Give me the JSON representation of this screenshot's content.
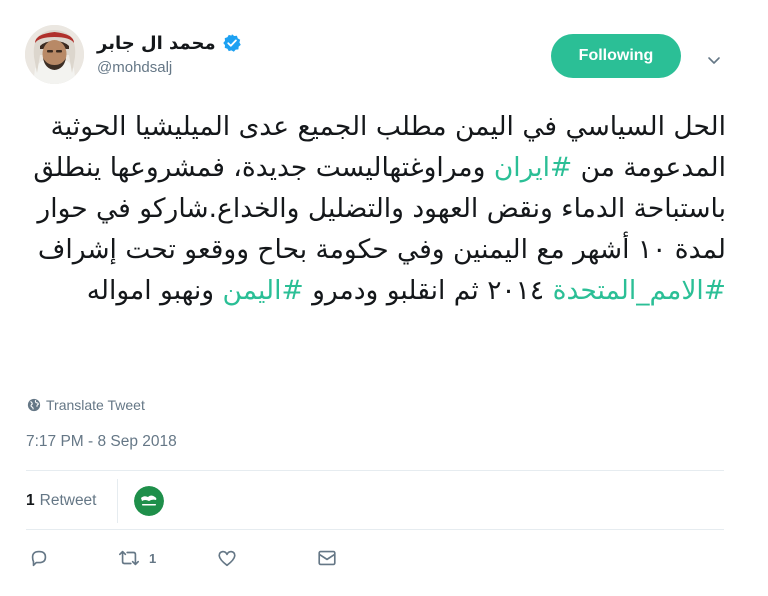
{
  "header": {
    "display_name": "محمد ال جابر",
    "handle": "@mohdsalj",
    "follow_label": "Following",
    "verified": true
  },
  "tweet": {
    "segments": [
      {
        "type": "text",
        "text": "الحل السياسي في اليمن مطلب الجميع عدى الميليشيا الحوثية المدعومة من "
      },
      {
        "type": "hashtag",
        "text": "#ايران"
      },
      {
        "type": "text",
        "text": " ومراوغتهاليست جديدة، فمشروعها ينطلق باستباحة الدماء ونقض العهود والتضليل والخداع.شاركو في حوار لمدة ١٠ أشهر مع اليمنين وفي حكومة بحاح ووقعو تحت إشراف "
      },
      {
        "type": "hashtag",
        "text": "#الامم_المتحدة"
      },
      {
        "type": "text",
        "text": " ٢٠١٤ ثم انقلبو ودمرو "
      },
      {
        "type": "hashtag",
        "text": "#اليمن"
      },
      {
        "type": "text",
        "text": " ونهبو امواله"
      }
    ]
  },
  "translate_label": "Translate Tweet",
  "timestamp": "7:17 PM - 8 Sep 2018",
  "stats": {
    "retweet_count": "1",
    "retweet_label": "Retweet"
  },
  "actions": {
    "retweet_count": "1"
  },
  "colors": {
    "accent": "#2bbf96",
    "verified": "#1da1f2",
    "muted": "#657786"
  },
  "icons": [
    "verified-badge-icon",
    "chevron-down-icon",
    "globe-icon",
    "reply-icon",
    "retweet-icon",
    "like-icon",
    "direct-message-icon"
  ]
}
